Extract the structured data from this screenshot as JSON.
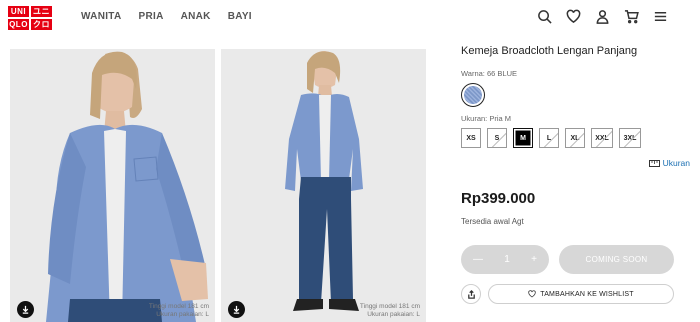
{
  "header": {
    "logo": [
      "UNI",
      "QLO",
      "ユニ",
      "クロ"
    ],
    "nav": [
      "WANITA",
      "PRIA",
      "ANAK",
      "BAYI"
    ],
    "icons": [
      "search-icon",
      "heart-icon",
      "user-icon",
      "cart-icon",
      "menu-icon"
    ]
  },
  "gallery": {
    "photos": [
      {
        "caption_line1": "Tinggi model 181 cm",
        "caption_line2": "Ukuran pakaian: L"
      },
      {
        "caption_line1": "Tinggi model 181 cm",
        "caption_line2": "Ukuran pakaian: L"
      }
    ]
  },
  "product": {
    "title": "Kemeja Broadcloth Lengan Panjang",
    "color_label": "Warna: 66 BLUE",
    "size_label": "Ukuran: Pria M",
    "sizes": [
      "XS",
      "S",
      "M",
      "L",
      "XL",
      "XXL",
      "3XL"
    ],
    "selected_size": "M",
    "size_guide": "Ukuran",
    "price": "Rp399.000",
    "availability": "Tersedia awal Agt",
    "quantity": "1",
    "minus": "—",
    "plus": "+",
    "coming_soon": "COMING SOON",
    "wishlist": "TAMBAHKAN KE WISHLIST"
  },
  "colors": {
    "brand": "#e60012",
    "shirt": "#7a98cc",
    "link": "#1b70b3",
    "disabled": "#d7d7d7"
  }
}
